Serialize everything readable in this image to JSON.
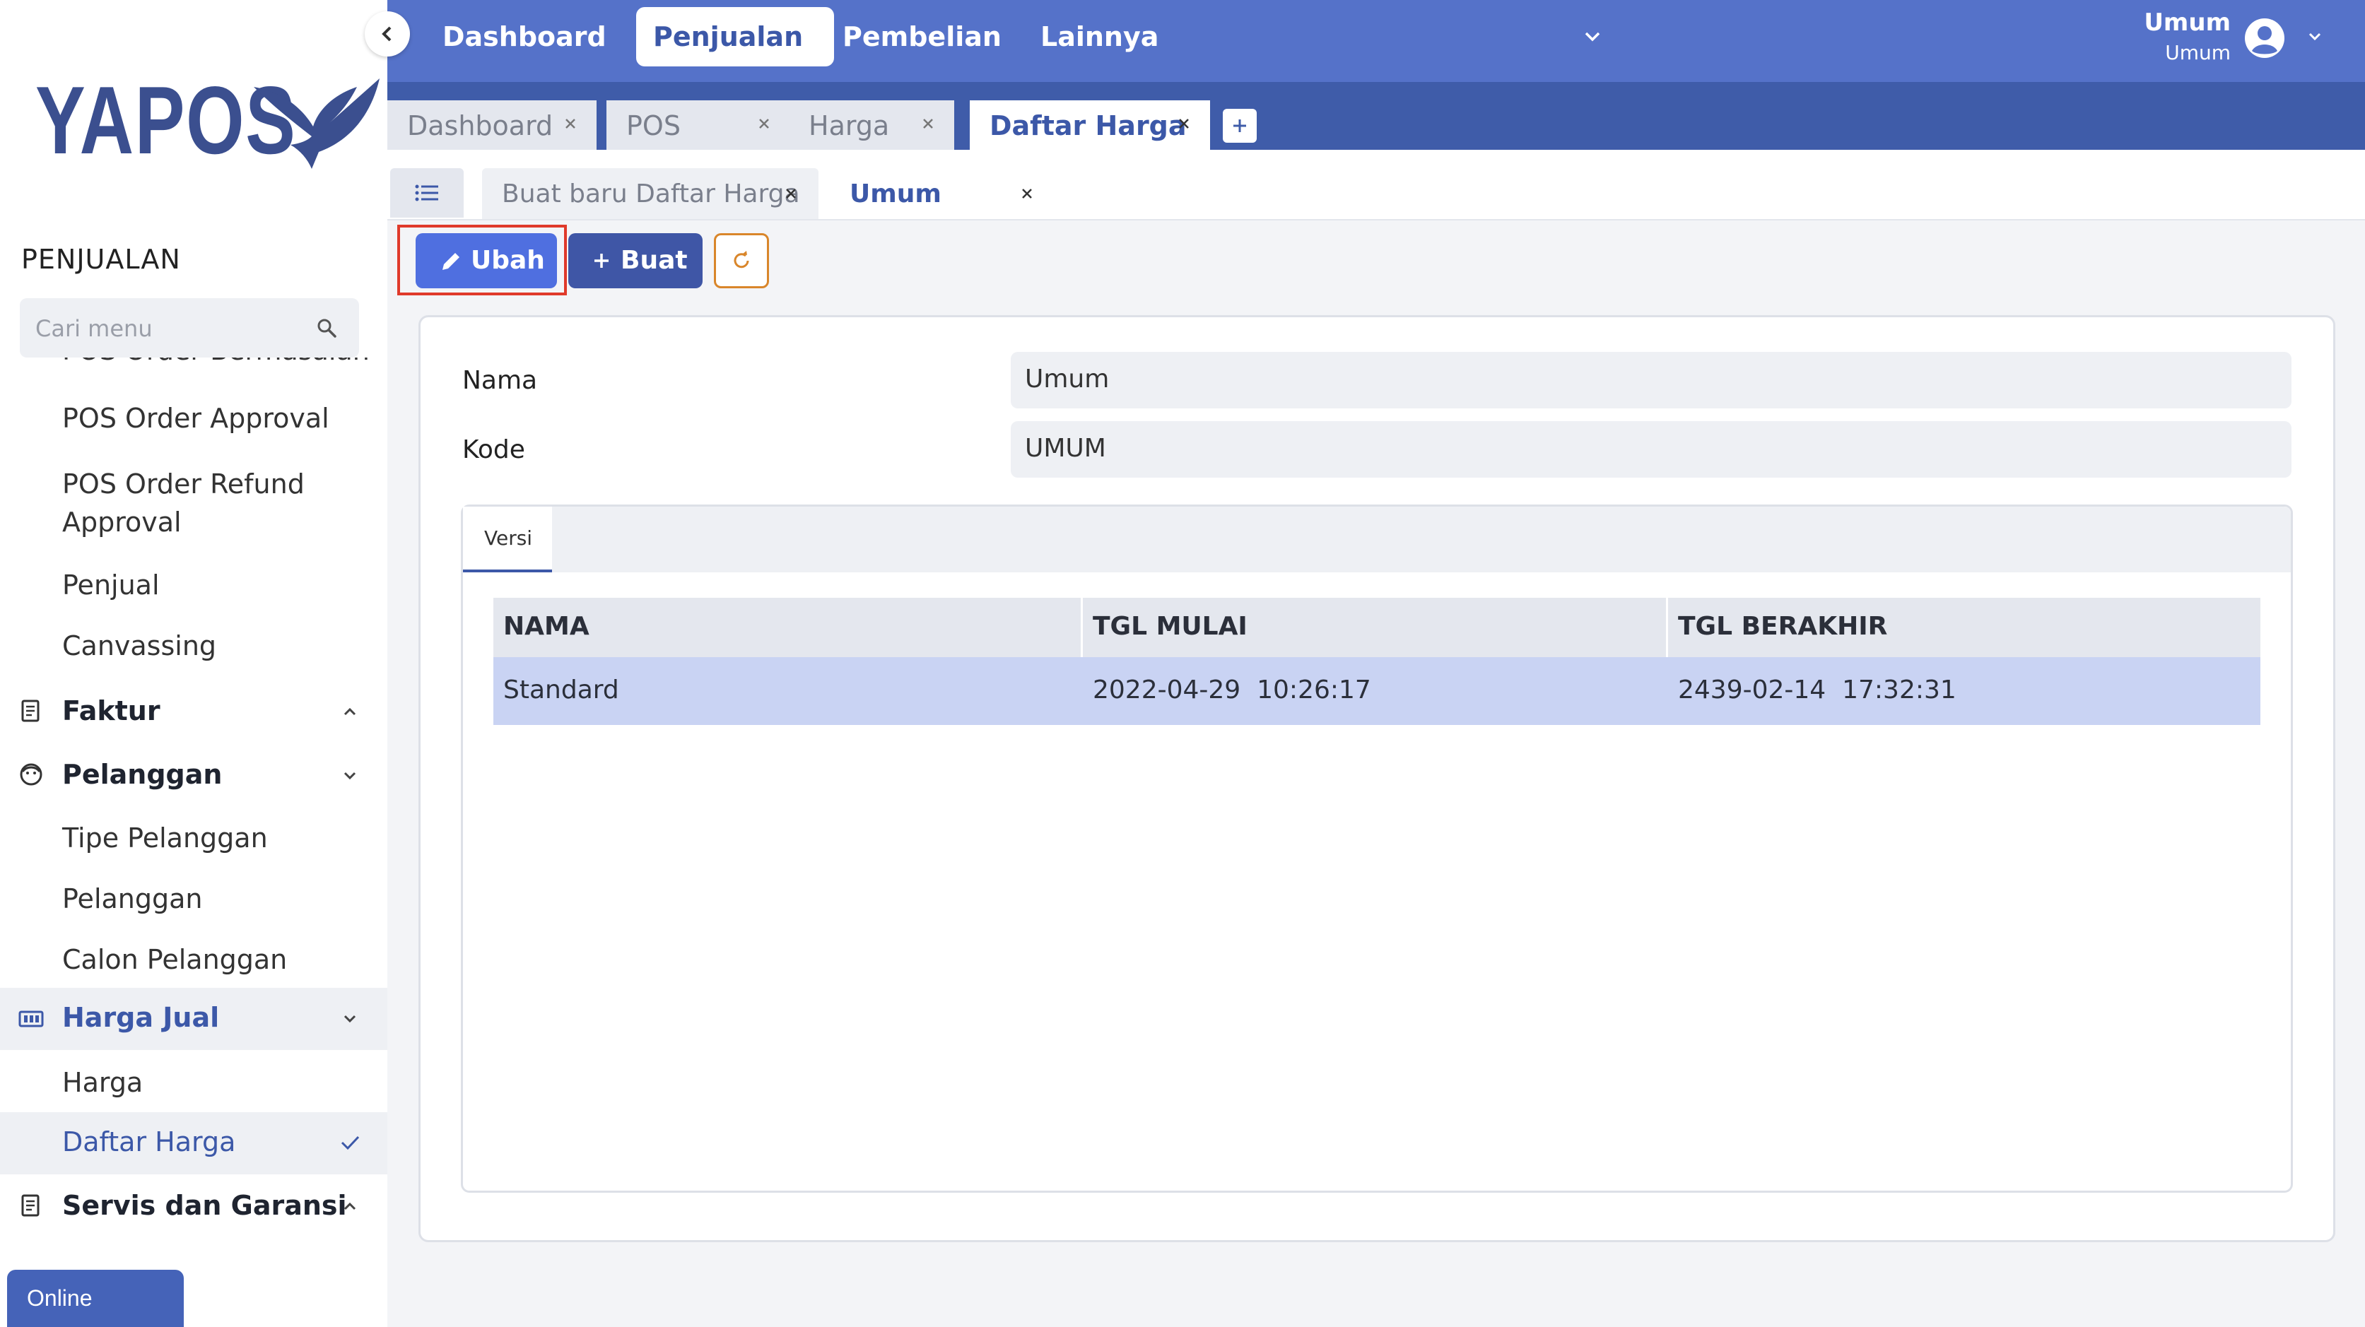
{
  "app": {
    "logo_text": "YAPOS"
  },
  "sidebar": {
    "section_title": "PENJUALAN",
    "search_placeholder": "Cari menu",
    "items": [
      {
        "label": "POS Order Bermasalah"
      },
      {
        "label": "POS Order Approval"
      },
      {
        "label": "POS Order Refund Approval"
      },
      {
        "label": "Penjual"
      },
      {
        "label": "Canvassing"
      },
      {
        "label": "Faktur"
      },
      {
        "label": "Pelanggan"
      },
      {
        "label": "Tipe Pelanggan"
      },
      {
        "label": "Pelanggan"
      },
      {
        "label": "Calon Pelanggan"
      },
      {
        "label": "Harga Jual"
      },
      {
        "label": "Harga"
      },
      {
        "label": "Daftar Harga"
      },
      {
        "label": "Servis dan Garansi"
      }
    ],
    "status_label": "Online",
    "colors": {
      "active": "#3c58a8"
    }
  },
  "topnav": {
    "items": [
      {
        "label": "Dashboard"
      },
      {
        "label": "Penjualan"
      },
      {
        "label": "Pembelian"
      },
      {
        "label": "Lainnya"
      }
    ],
    "active_item": "Penjualan",
    "user": {
      "name": "Umum",
      "role": "Umum"
    },
    "colors": {
      "bar": "#5572c9",
      "tabbar": "#3f5ca9"
    }
  },
  "tabs": {
    "items": [
      {
        "label": "Dashboard"
      },
      {
        "label": "POS"
      },
      {
        "label": "Harga"
      },
      {
        "label": "Daftar Harga"
      }
    ],
    "active_tab": "Daftar Harga"
  },
  "subtabs": {
    "items": [
      {
        "label": "Buat baru Daftar Harga"
      },
      {
        "label": "Umum"
      }
    ],
    "active_subtab": "Umum"
  },
  "toolbar": {
    "edit_label": "Ubah",
    "create_label": "Buat",
    "colors": {
      "edit": "#4f6fe0",
      "create": "#3f56a6",
      "highlight": "#e03a2b"
    }
  },
  "form": {
    "name_label": "Nama",
    "name_value": "Umum",
    "code_label": "Kode",
    "code_value": "UMUM"
  },
  "versions": {
    "tab_label": "Versi",
    "columns": [
      "NAMA",
      "TGL MULAI",
      "TGL BERAKHIR"
    ],
    "rows": [
      [
        "Standard",
        "2022-04-29  10:26:17",
        "2439-02-14  17:32:31"
      ]
    ],
    "selected_row_color": "#c9d3f3"
  }
}
